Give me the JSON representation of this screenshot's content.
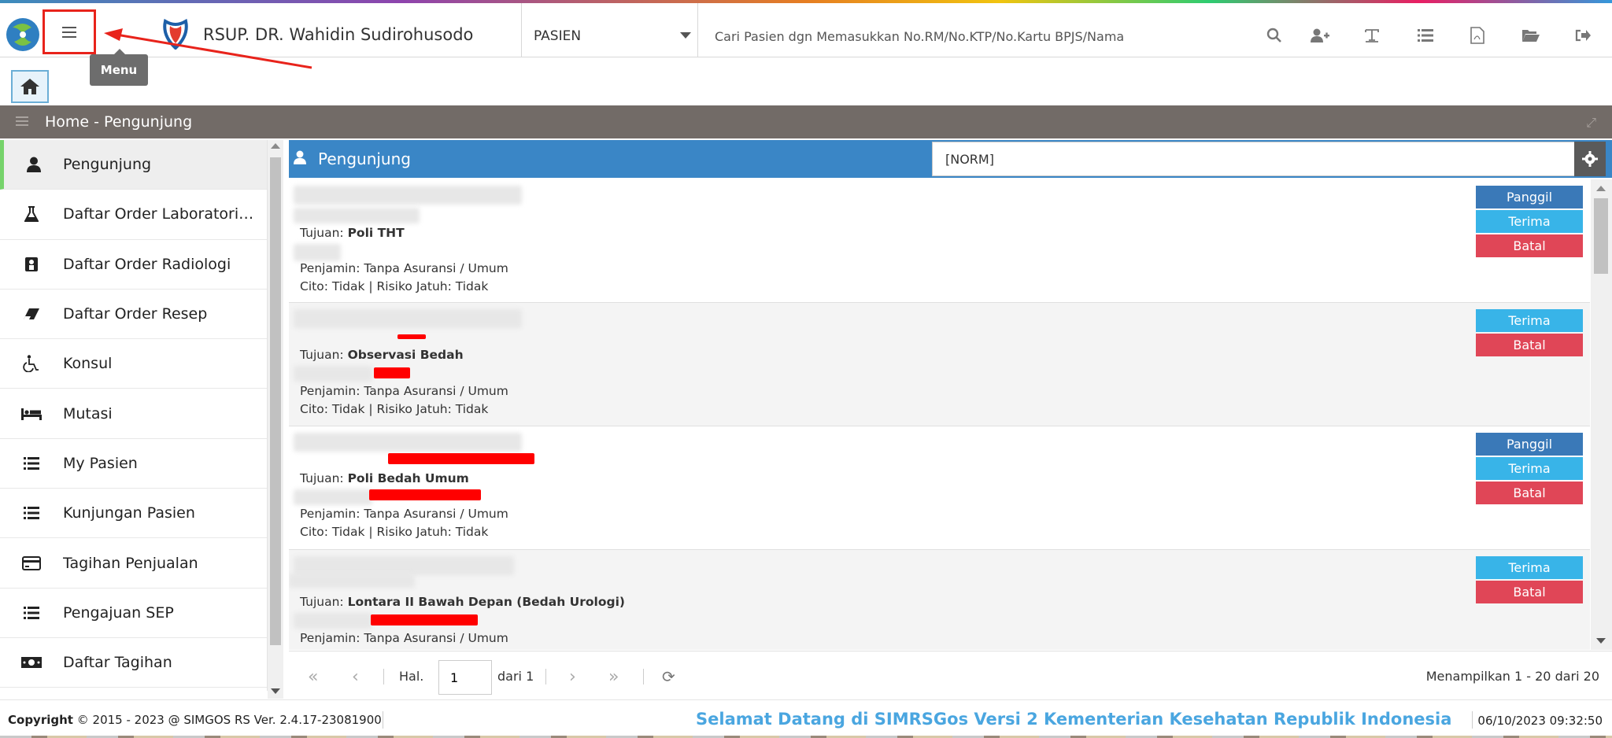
{
  "header": {
    "hospital_name": "RSUP. DR. Wahidin Sudirohusodo",
    "patient_select": "PASIEN",
    "search_placeholder": "Cari Pasien dgn Memasukkan No.RM/No.KTP/No.Kartu BPJS/Nama",
    "menu_tooltip": "Menu",
    "toolbar_icons": [
      "search-icon",
      "add-user-icon",
      "text-icon",
      "list-icon",
      "pdf-icon",
      "folder-open-icon",
      "logout-icon"
    ]
  },
  "breadcrumb": "Home - Pengunjung",
  "sidebar": {
    "items": [
      {
        "label": "Pengunjung",
        "icon": "user-icon",
        "active": true
      },
      {
        "label": "Daftar Order Laboratorium",
        "icon": "flask-icon"
      },
      {
        "label": "Daftar Order Radiologi",
        "icon": "radiology-icon"
      },
      {
        "label": "Daftar Order Resep",
        "icon": "eraser-icon"
      },
      {
        "label": "Konsul",
        "icon": "wheelchair-icon"
      },
      {
        "label": "Mutasi",
        "icon": "bed-icon"
      },
      {
        "label": "My Pasien",
        "icon": "list-icon"
      },
      {
        "label": "Kunjungan Pasien",
        "icon": "list-icon"
      },
      {
        "label": "Tagihan Penjualan",
        "icon": "credit-card-icon"
      },
      {
        "label": "Pengajuan SEP",
        "icon": "list-icon"
      },
      {
        "label": "Daftar Tagihan",
        "icon": "money-icon"
      }
    ]
  },
  "list": {
    "title": "Pengunjung",
    "search_value": "[NORM]",
    "rows": [
      {
        "tujuan_label": "Tujuan:",
        "tujuan": "Poli THT",
        "penjamin": "Penjamin: Tanpa Asuransi / Umum",
        "cito": "Cito: Tidak | Risiko Jatuh: Tidak",
        "buttons": [
          "Panggil",
          "Terima",
          "Batal"
        ]
      },
      {
        "tujuan_label": "Tujuan:",
        "tujuan": "Observasi Bedah",
        "penjamin": "Penjamin: Tanpa Asuransi / Umum",
        "cito": "Cito: Tidak | Risiko Jatuh: Tidak",
        "buttons": [
          "Terima",
          "Batal"
        ]
      },
      {
        "tujuan_label": "Tujuan:",
        "tujuan": "Poli Bedah Umum",
        "penjamin": "Penjamin: Tanpa Asuransi / Umum",
        "cito": "Cito: Tidak | Risiko Jatuh: Tidak",
        "buttons": [
          "Panggil",
          "Terima",
          "Batal"
        ]
      },
      {
        "tujuan_label": "Tujuan:",
        "tujuan": "Lontara II Bawah Depan (Bedah Urologi)",
        "penjamin": "Penjamin: Tanpa Asuransi / Umum",
        "cito": "",
        "buttons": [
          "Terima",
          "Batal"
        ]
      }
    ]
  },
  "pager": {
    "hal_label": "Hal.",
    "page": "1",
    "dari": "dari 1",
    "info": "Menampilkan 1 - 20 dari 20"
  },
  "footer": {
    "copyright_label": "Copyright",
    "copyright_text": "2015 - 2023 @ SIMGOS RS Ver. 2.4.17-23081900",
    "welcome": "Selamat Datang di SIMRSGos Versi 2 Kementerian Kesehatan Republik Indonesia",
    "datetime": "06/10/2023 09:32:50"
  },
  "colors": {
    "accent": "#3a86c6",
    "panggil": "#3a79b8",
    "terima": "#38b4e8",
    "batal": "#e04657",
    "active_marker": "#76d36b",
    "annotation": "#e8231b"
  }
}
